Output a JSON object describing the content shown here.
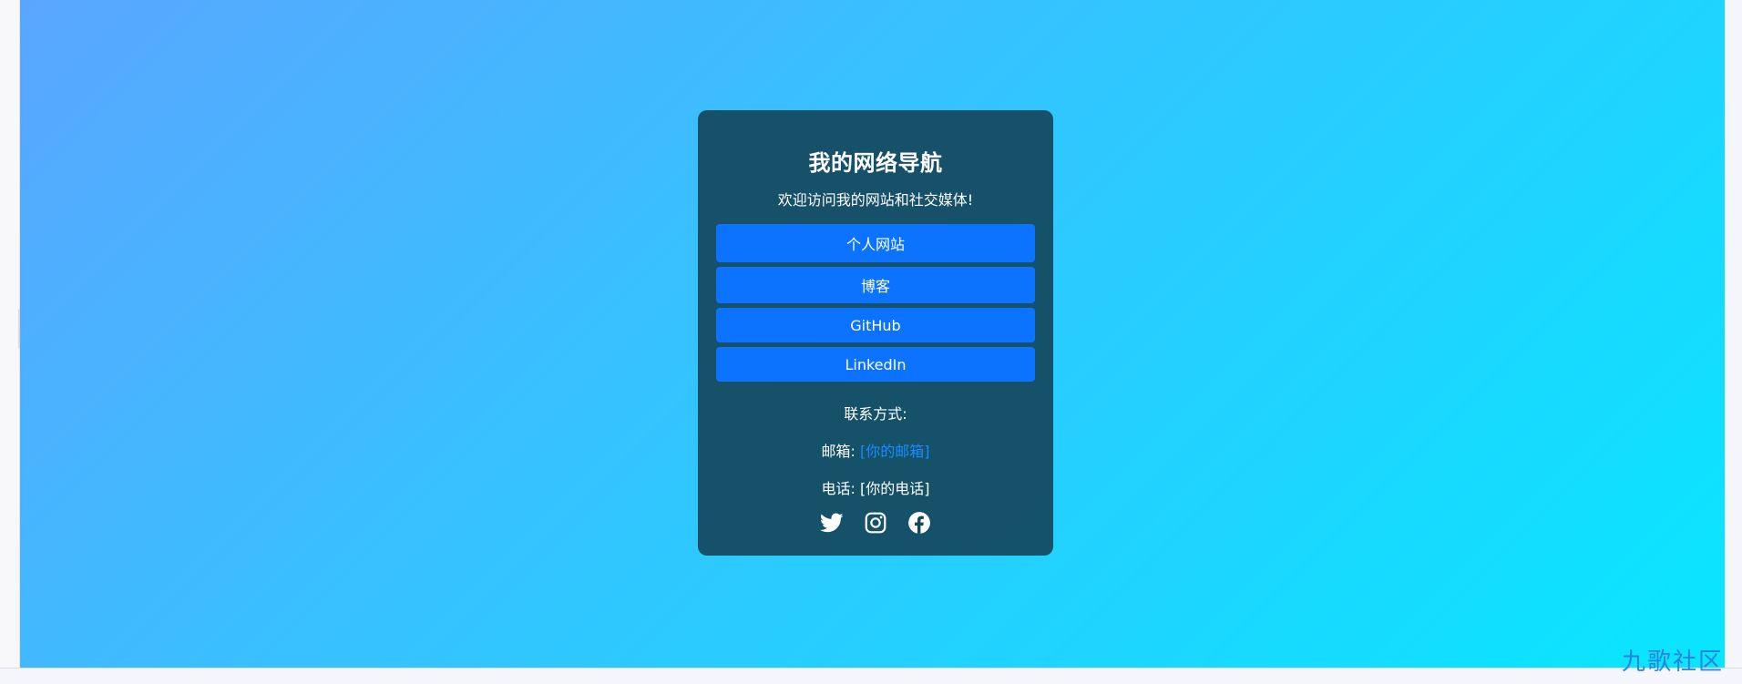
{
  "nav": {
    "title": "我的网络导航",
    "subtitle": "欢迎访问我的网站和社交媒体!",
    "links": [
      {
        "label": "个人网站"
      },
      {
        "label": "博客"
      },
      {
        "label": "GitHub"
      },
      {
        "label": "LinkedIn"
      }
    ]
  },
  "contact": {
    "heading": "联系方式:",
    "email_label": "邮箱:",
    "email_value": "[你的邮箱]",
    "phone_label": "电话:",
    "phone_value": "[你的电话]"
  },
  "social": {
    "icons": [
      "twitter-icon",
      "instagram-icon",
      "facebook-icon"
    ]
  },
  "watermark": {
    "text": "九歌社区"
  },
  "colors": {
    "card_bg": "#14465C",
    "button_bg": "#0B73FF",
    "link": "#1A8CFF",
    "gradient_start": "#5AA6FF",
    "gradient_end": "#08E6FF"
  }
}
